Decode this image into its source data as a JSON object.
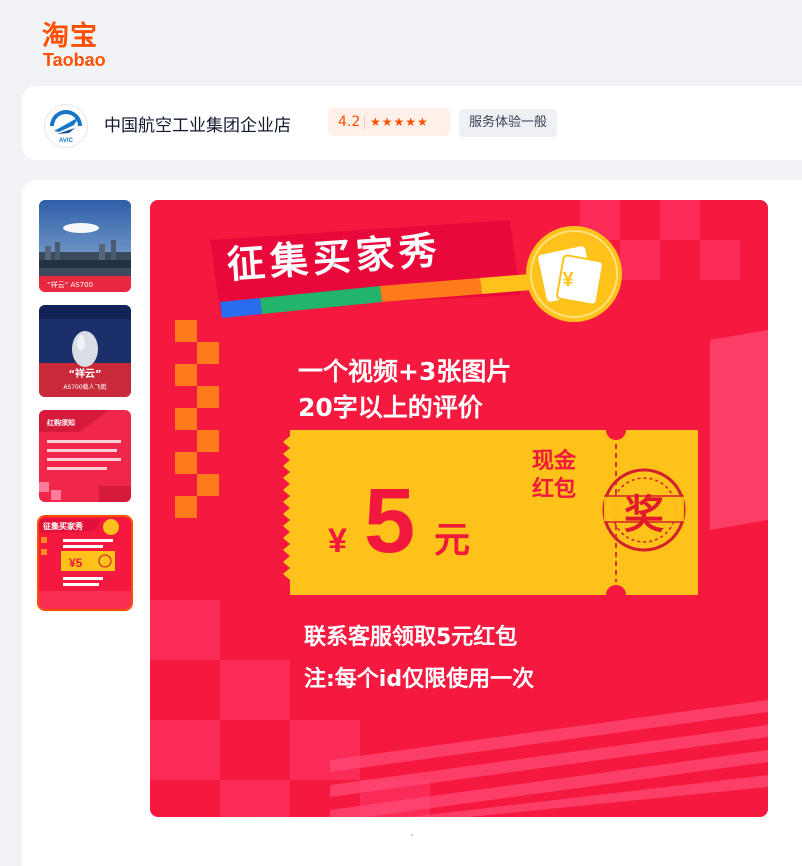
{
  "brand": {
    "logo_cn": "淘宝",
    "logo_en": "Taobao",
    "accent": "#ff5000"
  },
  "shop": {
    "name": "中国航空工业集团企业店",
    "avatar_text": "AVIC",
    "rating": "4.2",
    "stars": "★★★★★",
    "service": "服务体验一般"
  },
  "thumbnails": [
    {
      "caption": "“祥云” AS700",
      "icon": "airship-photo"
    },
    {
      "caption": "“祥云”",
      "sub": "AS700载人飞艇",
      "icon": "airship-poster"
    },
    {
      "caption": "红购须知",
      "icon": "notice-poster"
    },
    {
      "caption": "征集买家秀",
      "icon": "promo-poster",
      "active": true
    }
  ],
  "promo": {
    "title": "征集买家秀",
    "line1": "一个视频+3张图片",
    "line2": "20字以上的评价",
    "ticket_currency": "¥",
    "ticket_amount": "5",
    "ticket_unit": "元",
    "ticket_label_1": "现金",
    "ticket_label_2": "红包",
    "stamp": "奖",
    "bottom1": "联系客服领取5元红包",
    "bottom2": "注:每个id仅限使用一次",
    "colors": {
      "bg": "#f5193f",
      "ticket": "#ffc21a",
      "text": "#ffffff",
      "amount": "#f2183d"
    }
  }
}
